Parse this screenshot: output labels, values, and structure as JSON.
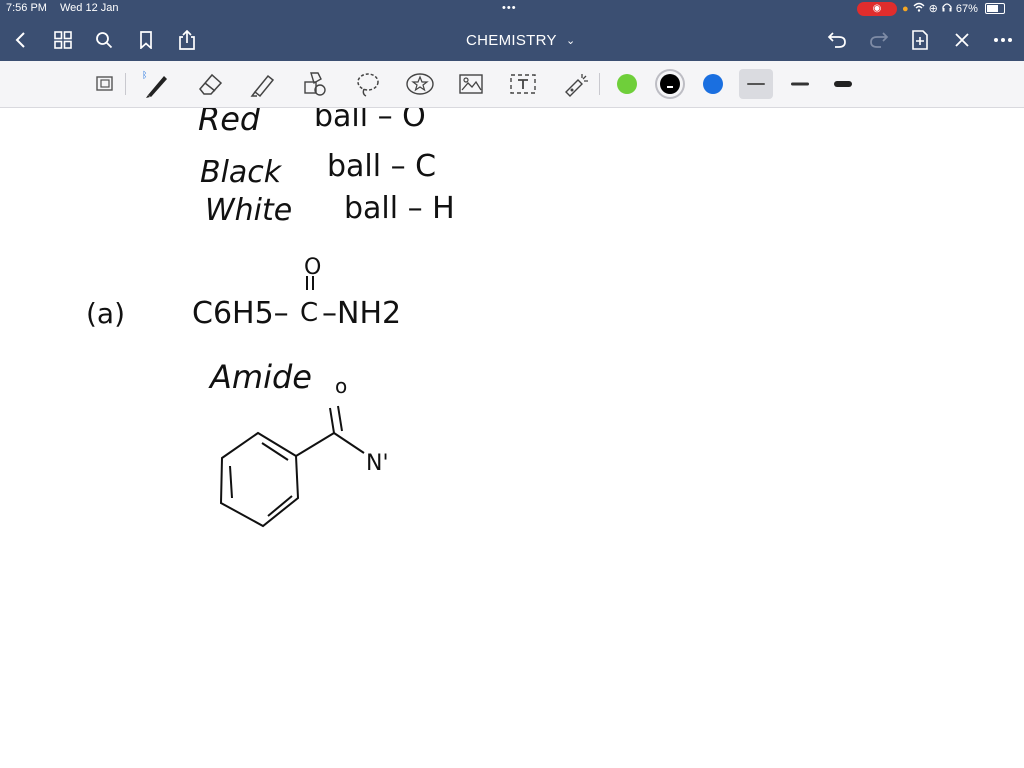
{
  "status_bar": {
    "time": "7:56 PM",
    "date": "Wed 12 Jan",
    "dots": "•••",
    "record_icon": "record-icon",
    "battery_text": "67%",
    "battery_level": 0.67
  },
  "nav": {
    "title": "CHEMISTRY",
    "title_chevron": "⌄",
    "back_icon": "chevron-left-icon",
    "grid_icon": "grid-icon",
    "search_icon": "search-icon",
    "bookmark_icon": "bookmark-icon",
    "share_icon": "share-icon",
    "undo_icon": "undo-icon",
    "redo_icon": "redo-icon",
    "add_page_icon": "add-page-icon",
    "close_icon": "close-icon",
    "more_icon": "more-icon"
  },
  "toolbar": {
    "colors": [
      "#6fcf3a",
      "#000000",
      "#1a6fe0"
    ],
    "selected_color_index": 1,
    "line_weights": [
      "thin",
      "medium",
      "thick"
    ],
    "selected_weight_index": 0
  },
  "note": {
    "lines": [
      {
        "label": "Red",
        "eq": "ball  –  O"
      },
      {
        "label": "Black",
        "eq": "ball  –  C"
      },
      {
        "label": "White",
        "eq": "ball  –  H"
      }
    ],
    "part_label": "(a)",
    "formula_left": "C6H5–",
    "formula_carbon": "C",
    "formula_right": "–NH2",
    "formula_oxygen": "O",
    "class_label": "Amide",
    "structure_o": "o",
    "structure_n": "N'"
  }
}
